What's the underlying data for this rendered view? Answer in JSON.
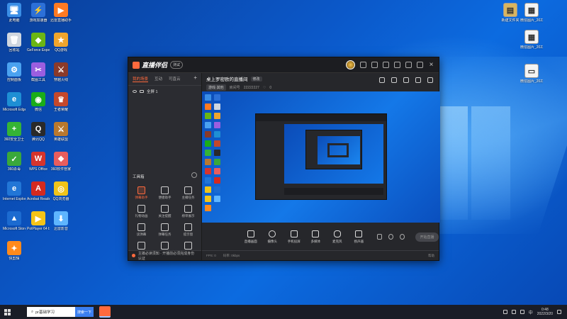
{
  "desktop_icons_left": [
    {
      "label": "此电脑",
      "color": "#3a8ee6",
      "glyph": "🖥"
    },
    {
      "label": "游戏加速器",
      "color": "#2c70d8",
      "glyph": "⚡"
    },
    {
      "label": "迅雷直播助手",
      "color": "#ff7a22",
      "glyph": "▶"
    },
    {
      "label": "回收站",
      "color": "#cfd6df",
      "glyph": "🗑"
    },
    {
      "label": "GeForce Experience",
      "color": "#6bb614",
      "glyph": "◆"
    },
    {
      "label": "QQ游戏",
      "color": "#f0a52c",
      "glyph": "★"
    },
    {
      "label": "控制面板",
      "color": "#4aa2f0",
      "glyph": "⚙"
    },
    {
      "label": "截图工具",
      "color": "#9a5ee0",
      "glyph": "✂"
    },
    {
      "label": "穿越火线",
      "color": "#8a3a2a",
      "glyph": "⚔"
    },
    {
      "label": "Microsoft Edge",
      "color": "#1e8fd4",
      "glyph": "e"
    },
    {
      "label": "微信",
      "color": "#1aad19",
      "glyph": "◉"
    },
    {
      "label": "王者荣耀",
      "color": "#c4482b",
      "glyph": "♛"
    },
    {
      "label": "360安全卫士",
      "color": "#35b435",
      "glyph": "+"
    },
    {
      "label": "腾讯QQ",
      "color": "#2a2a2a",
      "glyph": "Q"
    },
    {
      "label": "英雄联盟",
      "color": "#b8782e",
      "glyph": "⚔"
    },
    {
      "label": "360杀毒",
      "color": "#3aa83a",
      "glyph": "✓"
    },
    {
      "label": "WPS Office",
      "color": "#d6342c",
      "glyph": "W"
    },
    {
      "label": "360软件管家",
      "color": "#e85d5d",
      "glyph": "❖"
    },
    {
      "label": "Internet Explorer",
      "color": "#2276d6",
      "glyph": "e"
    },
    {
      "label": "Acrobat Reader DC",
      "color": "#d42a1f",
      "glyph": "A"
    },
    {
      "label": "QQ浏览器",
      "color": "#f0c419",
      "glyph": "◎"
    },
    {
      "label": "Microsoft Store",
      "color": "#1c6bd0",
      "glyph": "▲"
    },
    {
      "label": "PotPlayer 64 bit",
      "color": "#f5c418",
      "glyph": "▶"
    },
    {
      "label": "迅雷影音",
      "color": "#5eb5ff",
      "glyph": "⬇"
    },
    {
      "label": "快剪辑",
      "color": "#ff8a1c",
      "glyph": "✦"
    }
  ],
  "desktop_icons_right": [
    {
      "label": "新建文件夹",
      "color": "#d9b560",
      "glyph": "▤"
    },
    {
      "label": "微信图片_2022022...",
      "color": "#f4f4f4",
      "glyph": "▦"
    },
    {
      "label": "微信图片_2022022...",
      "color": "#f4f4f4",
      "glyph": "▦"
    },
    {
      "label": "微信图片_2022031...",
      "color": "#f4f4f4",
      "glyph": "▭"
    }
  ],
  "app": {
    "title": "直播伴侣",
    "version_badge": "测试"
  },
  "left_panel": {
    "tabs": [
      "我的场景",
      "互动",
      "可直云"
    ],
    "active_tab": 0,
    "add_symbol": "+",
    "scene": "全屏 1",
    "toolbox_title": "工具箱",
    "tools": [
      "弹幕助手",
      "便捷助手",
      "主播任务",
      "礼物动画",
      "关注提醒",
      "榜单展示",
      "读弹幕",
      "弹幕任务",
      "提示窗",
      "直播画质",
      "游戏模式",
      "实时统计"
    ],
    "notice": "主播必读须知 · 开播前必须完成身份认证"
  },
  "room": {
    "title": "桌上罗密欧的直播间",
    "edit_label": "修改",
    "category": "游戏·其他",
    "room_id_label": "房间号",
    "room_id": "22222227",
    "likes": "0"
  },
  "controls": [
    "直播画面",
    "摄像头",
    "手机投屏",
    "多媒体",
    "麦克风",
    "扬声器"
  ],
  "start_button": "开始直播",
  "status_bar": {
    "fps": "FPS: 0",
    "bitrate": "码率: 0kbps",
    "help": "帮助"
  },
  "taskbar": {
    "search_text": "pr基础学习",
    "search_button": "搜索一下",
    "ime": "中",
    "time": "0:48",
    "date": "2022/3/20"
  },
  "colors": {
    "accent": "#ff6a3d",
    "window_bg": "#26272b",
    "desktop_blue": "#0b58c9"
  }
}
